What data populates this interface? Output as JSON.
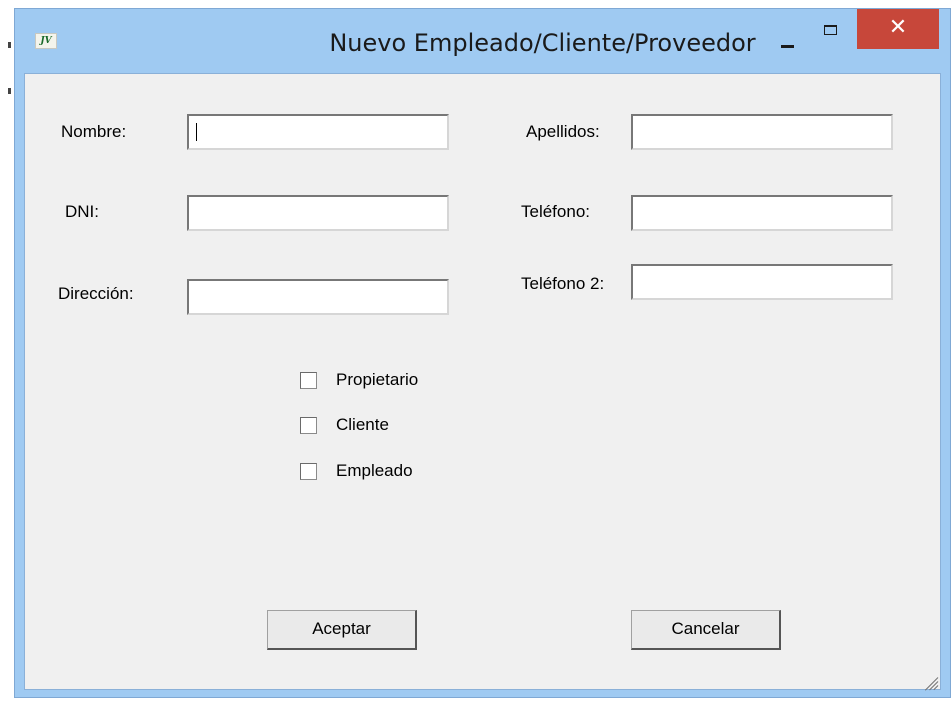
{
  "window": {
    "title": "Nuevo Empleado/Cliente/Proveedor",
    "icon": "app-icon",
    "close_glyph": "✕"
  },
  "form": {
    "nombre": {
      "label": "Nombre:",
      "value": ""
    },
    "apellidos": {
      "label": "Apellidos:",
      "value": ""
    },
    "dni": {
      "label": "DNI:",
      "value": ""
    },
    "telefono": {
      "label": "Teléfono:",
      "value": ""
    },
    "direccion": {
      "label": "Dirección:",
      "value": ""
    },
    "telefono2": {
      "label": "Teléfono 2:",
      "value": ""
    }
  },
  "checkboxes": [
    {
      "label": "Propietario",
      "checked": false
    },
    {
      "label": "Cliente",
      "checked": false
    },
    {
      "label": "Empleado",
      "checked": false
    }
  ],
  "buttons": {
    "accept": "Aceptar",
    "cancel": "Cancelar"
  },
  "colors": {
    "titlebar": "#9fcaf2",
    "close_button": "#c7473a",
    "client_area": "#f0f0f0"
  }
}
